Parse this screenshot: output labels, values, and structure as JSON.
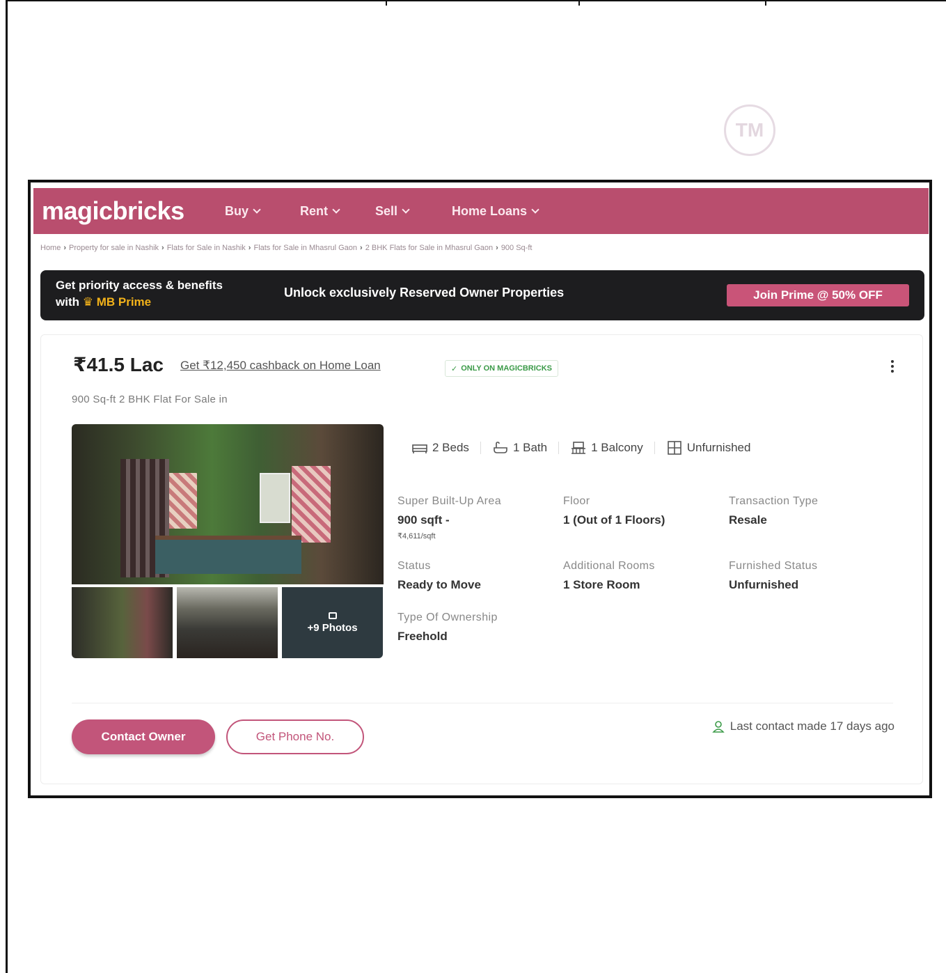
{
  "watermark": {
    "tm": "TM"
  },
  "nav": {
    "logo": "magicbricks",
    "items": [
      {
        "label": "Buy"
      },
      {
        "label": "Rent"
      },
      {
        "label": "Sell"
      },
      {
        "label": "Home Loans"
      }
    ]
  },
  "breadcrumb": [
    "Home",
    "Property for sale in Nashik",
    "Flats for Sale in Nashik",
    "Flats for Sale in Mhasrul Gaon",
    "2 BHK Flats for Sale in Mhasrul Gaon",
    "900 Sq-ft"
  ],
  "prime_banner": {
    "line1": "Get priority access & benefits",
    "line2_prefix": "with",
    "line2_brand": "MB Prime",
    "headline": "Unlock exclusively Reserved Owner Properties",
    "cta": "Join Prime @ 50% OFF"
  },
  "listing": {
    "price": "₹41.5 Lac",
    "cashback": "Get ₹12,450 cashback on Home Loan",
    "badge": "ONLY ON MAGICBRICKS",
    "subtitle": "900 Sq-ft 2 BHK Flat For Sale in",
    "more_photos": "+9 Photos",
    "features": [
      {
        "icon": "bed-icon",
        "label": "2 Beds"
      },
      {
        "icon": "bath-icon",
        "label": "1 Bath"
      },
      {
        "icon": "balcony-icon",
        "label": "1 Balcony"
      },
      {
        "icon": "furnishing-icon",
        "label": "Unfurnished"
      }
    ],
    "details": {
      "super_area": {
        "label": "Super Built-Up Area",
        "value": "900 sqft -",
        "sub": "₹4,611/sqft"
      },
      "floor": {
        "label": "Floor",
        "value": "1 (Out of 1 Floors)"
      },
      "transaction": {
        "label": "Transaction Type",
        "value": "Resale"
      },
      "status": {
        "label": "Status",
        "value": "Ready to Move"
      },
      "additional_rooms": {
        "label": "Additional Rooms",
        "value": "1 Store Room"
      },
      "furnished": {
        "label": "Furnished Status",
        "value": "Unfurnished"
      },
      "ownership": {
        "label": "Type Of Ownership",
        "value": "Freehold"
      }
    },
    "contact_owner": "Contact Owner",
    "get_phone": "Get Phone No.",
    "last_contact": "Last contact made 17 days ago"
  },
  "colors": {
    "brand": "#b94e6e",
    "cta": "#c95478",
    "banner_bg": "#1d1d1f",
    "prime_gold": "#f2b21a",
    "verified_green": "#3a9a47"
  }
}
